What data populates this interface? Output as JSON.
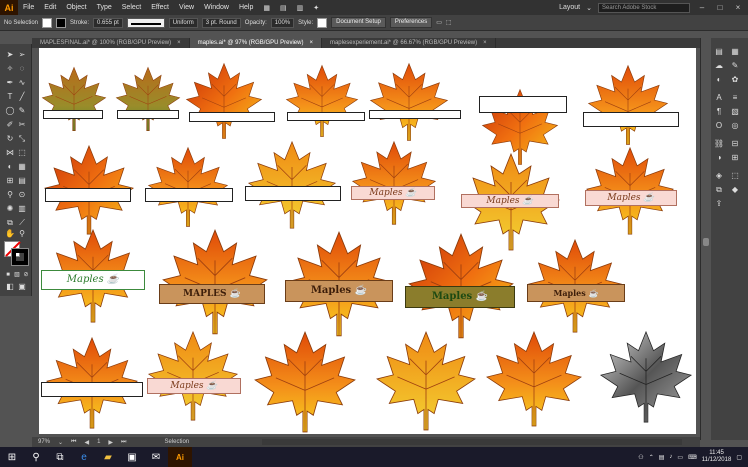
{
  "menubar": {
    "logo": "Ai",
    "items": [
      "File",
      "Edit",
      "Object",
      "Type",
      "Select",
      "Effect",
      "View",
      "Window",
      "Help"
    ],
    "workspace": "Layout",
    "search_placeholder": "Search Adobe Stock"
  },
  "controlbar": {
    "selection": "No Selection",
    "stroke_label": "Stroke:",
    "stroke_value": "0.655 pt",
    "profile": "Uniform",
    "brush": "3 pt. Round",
    "opacity_label": "Opacity:",
    "opacity_value": "100%",
    "style_label": "Style:",
    "doc_setup": "Document Setup",
    "preferences": "Preferences"
  },
  "tabs": [
    {
      "label": "MAPLESFINAL.ai* @ 100% (RGB/GPU Preview)",
      "active": false
    },
    {
      "label": "maples.ai* @ 97% (RGB/GPU Preview)",
      "active": true
    },
    {
      "label": "maplesexperiement.ai* @ 66.67% (RGB/GPU Preview)",
      "active": false
    }
  ],
  "tab_close": "×",
  "banners": {
    "maples_script": "Maples",
    "maples_caps": "MAPLES"
  },
  "statusbar": {
    "zoom": "97%",
    "artboard": "1",
    "tool": "Selection"
  },
  "taskbar": {
    "time": "11:45",
    "date": "11/12/2018"
  },
  "colors": {
    "leaf_orange": "#f07a10",
    "leaf_yellow": "#f5c020",
    "leaf_red": "#d8400a",
    "ui_dark": "#323232",
    "ai_orange": "#ff9a00"
  }
}
